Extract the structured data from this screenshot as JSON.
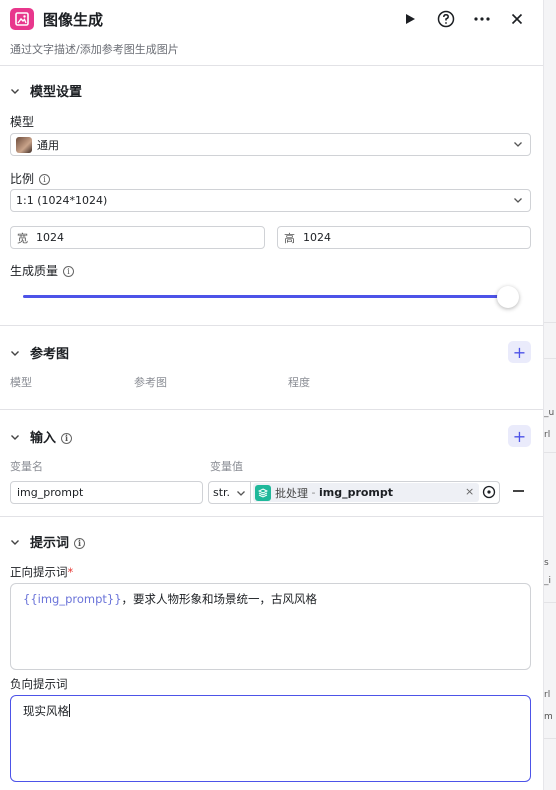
{
  "header": {
    "title": "图像生成",
    "subtitle": "通过文字描述/添加参考图生成图片"
  },
  "model_settings": {
    "title": "模型设置",
    "model_label": "模型",
    "model_value": "通用",
    "ratio_label": "比例",
    "ratio_value": "1:1 (1024*1024)",
    "width_prefix": "宽",
    "width_value": "1024",
    "height_prefix": "高",
    "height_value": "1024",
    "quality_label": "生成质量",
    "quality_level": 0.98
  },
  "reference": {
    "title": "参考图",
    "columns": [
      "模型",
      "参考图",
      "程度"
    ]
  },
  "input": {
    "title": "输入",
    "col_name": "变量名",
    "col_value": "变量值",
    "var_name": "img_prompt",
    "type": "str.",
    "source_node": "批处理",
    "source_sep": " - ",
    "source_var": "img_prompt"
  },
  "prompt": {
    "title": "提示词",
    "positive_label": "正向提示词",
    "required_mark": "*",
    "positive_var": "{{img_prompt}}",
    "positive_text": "，要求人物形象和场景统一，古风风格",
    "negative_label": "负向提示词",
    "negative_text": "现实风格"
  },
  "side_fragments": [
    "_u",
    "rl",
    "s",
    "_i",
    "rl",
    "m"
  ],
  "colors": {
    "accent": "#4d53e8",
    "brand": "#e8378c",
    "batch_icon": "#1fb89a"
  }
}
